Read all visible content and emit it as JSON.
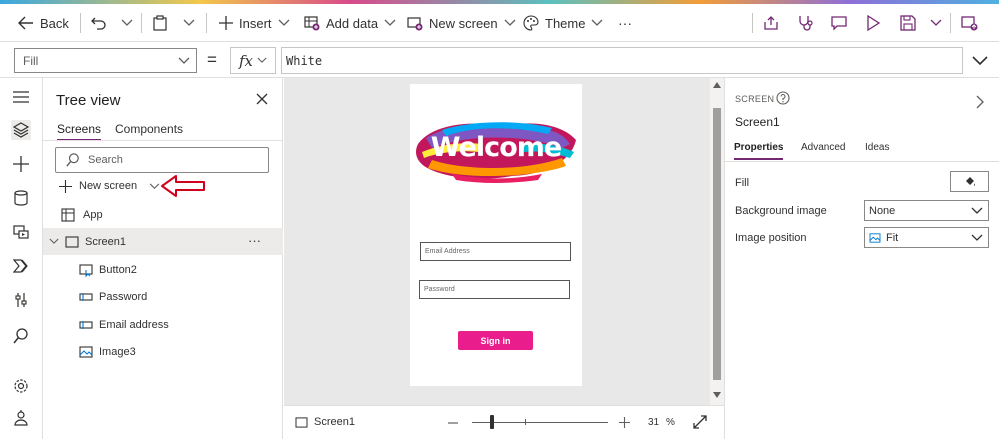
{
  "colors": {
    "accent": "#742774",
    "signin_bg": "#e91e8c",
    "arrow": "#d0021b"
  },
  "toolbar": {
    "back_label": "Back",
    "insert_label": "Insert",
    "add_data_label": "Add data",
    "new_screen_label": "New screen",
    "theme_label": "Theme",
    "more_label": "···"
  },
  "formula": {
    "property": "Fill",
    "equals": "=",
    "fx": "fx",
    "value": "White"
  },
  "tree": {
    "title": "Tree view",
    "tabs": [
      "Screens",
      "Components"
    ],
    "search_placeholder": "Search",
    "new_screen_label": "New screen",
    "items": [
      {
        "label": "App",
        "icon": "app-icon"
      },
      {
        "label": "Screen1",
        "icon": "screen-icon"
      },
      {
        "label": "Button2",
        "icon": "button-icon"
      },
      {
        "label": "Password",
        "icon": "textinput-icon"
      },
      {
        "label": "Email address",
        "icon": "textinput-icon"
      },
      {
        "label": "Image3",
        "icon": "image-icon"
      }
    ],
    "more_label": "···"
  },
  "app_screen": {
    "welcome_text": "Welcome",
    "email_placeholder": "Email Address",
    "password_placeholder": "Password",
    "signin_label": "Sign in"
  },
  "status": {
    "screen_label": "Screen1",
    "zoom_value": "31",
    "zoom_unit": "%"
  },
  "props": {
    "section": "SCREEN",
    "screen_name": "Screen1",
    "tabs": [
      "Properties",
      "Advanced",
      "Ideas"
    ],
    "fill_label": "Fill",
    "bg_image_label": "Background image",
    "bg_image_value": "None",
    "image_position_label": "Image position",
    "image_position_value": "Fit"
  }
}
